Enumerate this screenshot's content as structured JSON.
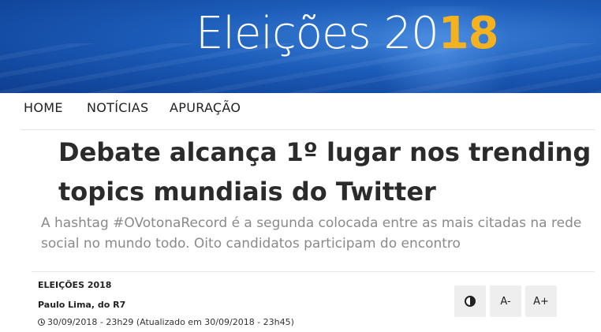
{
  "banner": {
    "title_word": "Eleições ",
    "title_year_plain": "20",
    "title_year_accent": "18"
  },
  "nav": {
    "items": [
      {
        "label": "HOME"
      },
      {
        "label": "NOTÍCIAS"
      },
      {
        "label": "APURAÇÃO"
      }
    ]
  },
  "article": {
    "headline": "Debate alcança 1º lugar nos trending topics mundiais do Twitter",
    "subtitle": "A  hashtag #OVotonaRecord é a segunda colocada entre as mais citadas na rede social no mundo todo. Oito candidatos participam do encontro",
    "section": "ELEIÇÕES 2018",
    "author": "Paulo Lima, do R7",
    "date": "30/09/2018 - 23h29 (Atualizado em 30/09/2018 - 23h45)"
  },
  "tools": {
    "contrast_icon": "contrast-icon",
    "font_decrease_label": "A-",
    "font_increase_label": "A+"
  },
  "colors": {
    "banner_blue": "#1b5bb8",
    "year_accent": "#f5b21f",
    "headline": "#2b2b2b",
    "subtitle": "#8a8a8a",
    "tool_bg": "#eeeeee"
  }
}
